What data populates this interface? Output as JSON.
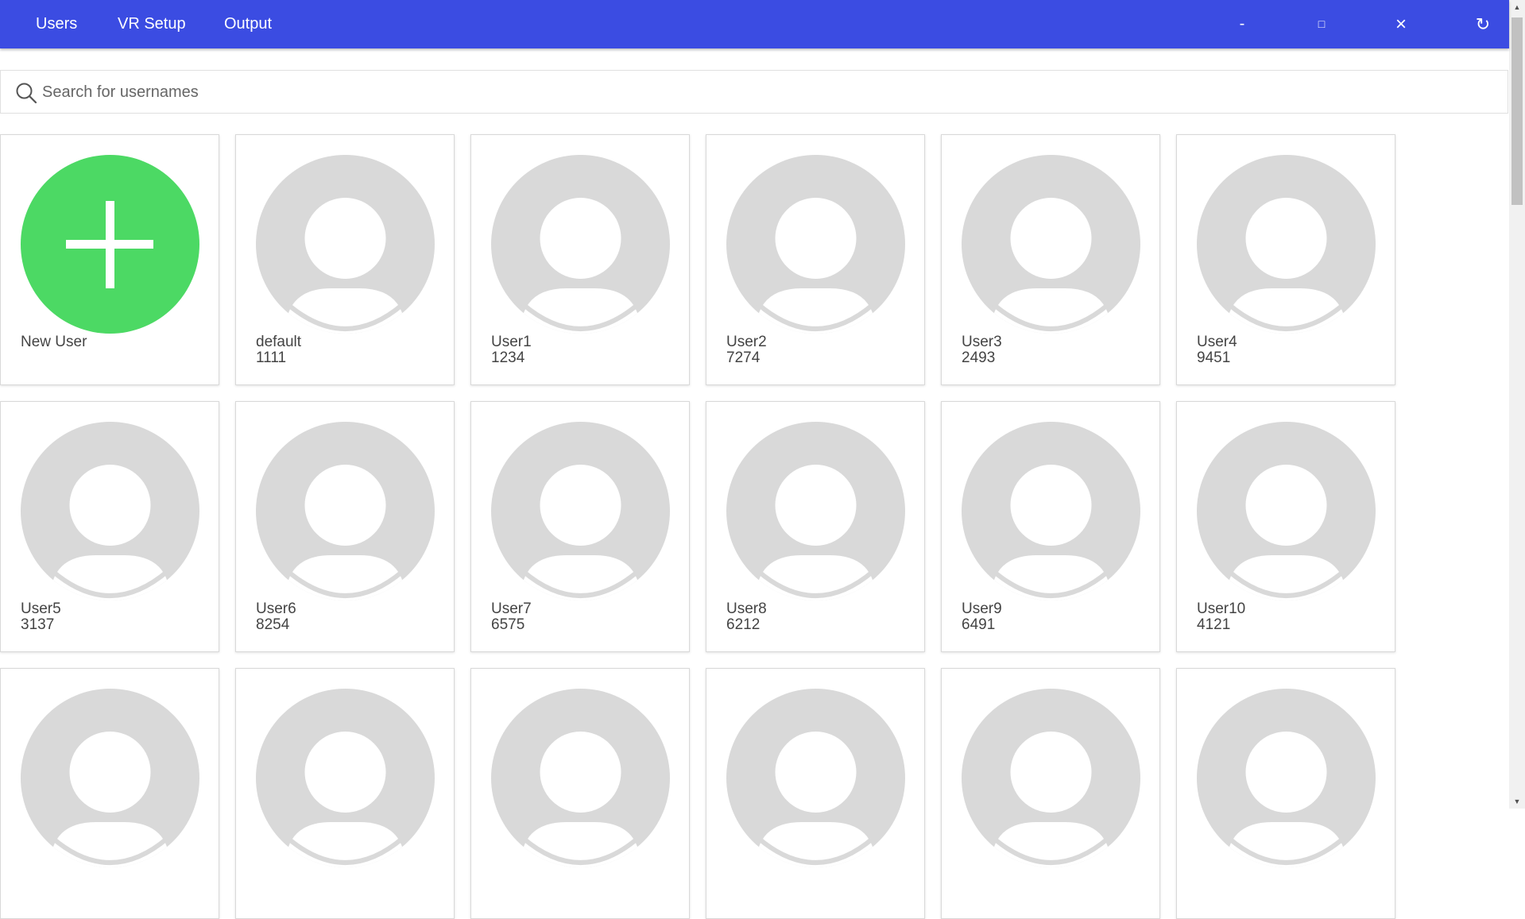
{
  "nav": {
    "items": [
      {
        "label": "Users"
      },
      {
        "label": "VR Setup"
      },
      {
        "label": "Output"
      }
    ]
  },
  "window": {
    "minimize": "-",
    "maximize": "□",
    "close": "×",
    "refresh": "↻"
  },
  "search": {
    "placeholder": "Search for usernames",
    "value": ""
  },
  "new_user": {
    "label": "New User",
    "color": "#4cd964"
  },
  "users": [
    {
      "name": "default",
      "pin": "1111"
    },
    {
      "name": "User1",
      "pin": "1234"
    },
    {
      "name": "User2",
      "pin": "7274"
    },
    {
      "name": "User3",
      "pin": "2493"
    },
    {
      "name": "User4",
      "pin": "9451"
    },
    {
      "name": "User5",
      "pin": "3137"
    },
    {
      "name": "User6",
      "pin": "8254"
    },
    {
      "name": "User7",
      "pin": "6575"
    },
    {
      "name": "User8",
      "pin": "6212"
    },
    {
      "name": "User9",
      "pin": "6491"
    },
    {
      "name": "User10",
      "pin": "4121"
    },
    {
      "name": "",
      "pin": ""
    },
    {
      "name": "",
      "pin": ""
    },
    {
      "name": "",
      "pin": ""
    },
    {
      "name": "",
      "pin": ""
    },
    {
      "name": "",
      "pin": ""
    },
    {
      "name": "",
      "pin": ""
    }
  ],
  "colors": {
    "header": "#3b4ce2",
    "avatar_bg": "#d9d9d9",
    "avatar_fg": "#ffffff"
  }
}
